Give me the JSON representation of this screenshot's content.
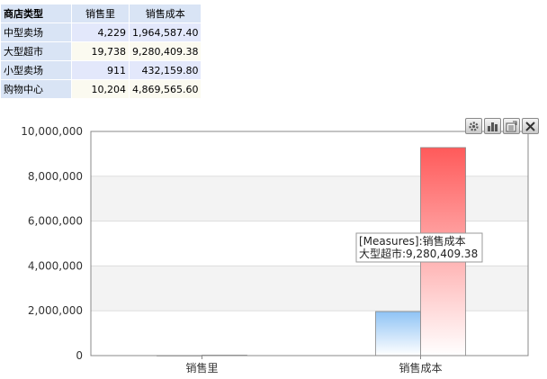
{
  "table": {
    "headers": [
      "商店类型",
      "销售里",
      "销售成本"
    ],
    "rows": [
      {
        "label": "中型卖场",
        "sales": "4,229",
        "cost": "1,964,587.40"
      },
      {
        "label": "大型超市",
        "sales": "19,738",
        "cost": "9,280,409.38"
      },
      {
        "label": "小型卖场",
        "sales": "911",
        "cost": "432,159.80"
      },
      {
        "label": "购物中心",
        "sales": "10,204",
        "cost": "4,869,565.60"
      }
    ]
  },
  "toolbar": {
    "icons": [
      "settings-icon",
      "chart-type-icon",
      "export-icon",
      "close-icon"
    ]
  },
  "tooltip": {
    "line1": "[Measures]:销售成本",
    "line2": "大型超市:9,280,409.38"
  },
  "chart_data": {
    "type": "bar",
    "categories": [
      "销售里",
      "销售成本"
    ],
    "series": [
      {
        "name": "中型卖场",
        "values": [
          4229,
          1964587.4
        ]
      },
      {
        "name": "大型超市",
        "values": [
          19738,
          9280409.38
        ]
      }
    ],
    "ylim": [
      0,
      10000000
    ],
    "yticks": [
      0,
      2000000,
      4000000,
      6000000,
      8000000,
      10000000
    ],
    "ytick_labels": [
      "0",
      "2,000,000",
      "4,000,000",
      "6,000,000",
      "8,000,000",
      "10,000,000"
    ],
    "series_colors": [
      "#9cc8f2",
      "#ff5f5f"
    ],
    "grid": "horizontal alternating bands",
    "legend": "none"
  }
}
